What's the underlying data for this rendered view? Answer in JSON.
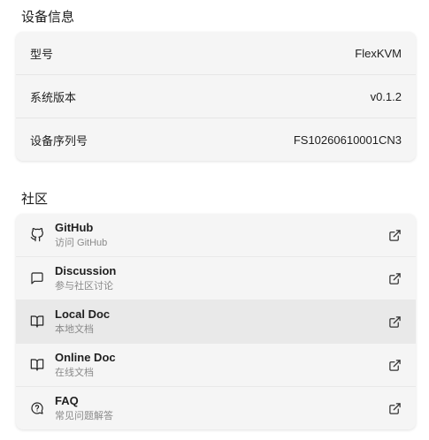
{
  "device_info": {
    "title": "设备信息",
    "rows": [
      {
        "label": "型号",
        "value": "FlexKVM"
      },
      {
        "label": "系统版本",
        "value": "v0.1.2"
      },
      {
        "label": "设备序列号",
        "value": "FS10260610001CN3"
      }
    ]
  },
  "community": {
    "title": "社区",
    "items": [
      {
        "title": "GitHub",
        "subtitle": "访问 GitHub",
        "icon": "github-icon"
      },
      {
        "title": "Discussion",
        "subtitle": "参与社区讨论",
        "icon": "chat-icon"
      },
      {
        "title": "Local Doc",
        "subtitle": "本地文档",
        "icon": "book-icon"
      },
      {
        "title": "Online Doc",
        "subtitle": "在线文档",
        "icon": "book-icon"
      },
      {
        "title": "FAQ",
        "subtitle": "常见问题解答",
        "icon": "help-circle-icon"
      }
    ]
  }
}
